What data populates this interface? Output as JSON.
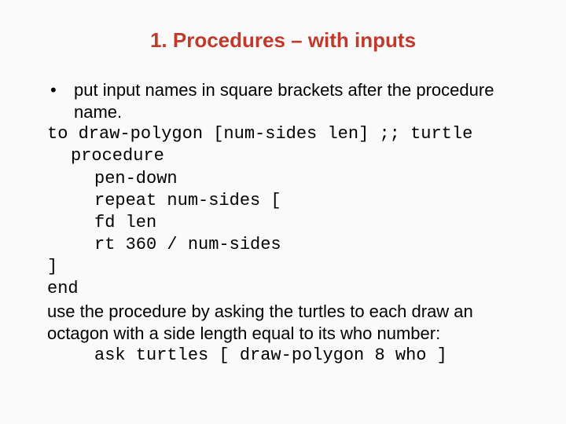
{
  "title": "1. Procedures – with inputs",
  "bullet_mark": "•",
  "bullet_text": "put input names in square brackets after the procedure name.",
  "code": {
    "l1": "to draw-polygon [num-sides len] ;; turtle",
    "l2": "procedure",
    "l3": "pen-down",
    "l4": "repeat num-sides [",
    "l5": "fd len",
    "l6": "rt 360 / num-sides",
    "l7": "]",
    "l8": "end"
  },
  "followup": "use the procedure by asking the turtles to each draw an octagon with a side length equal to its who number:",
  "code2": "ask turtles [ draw-polygon 8 who ]"
}
